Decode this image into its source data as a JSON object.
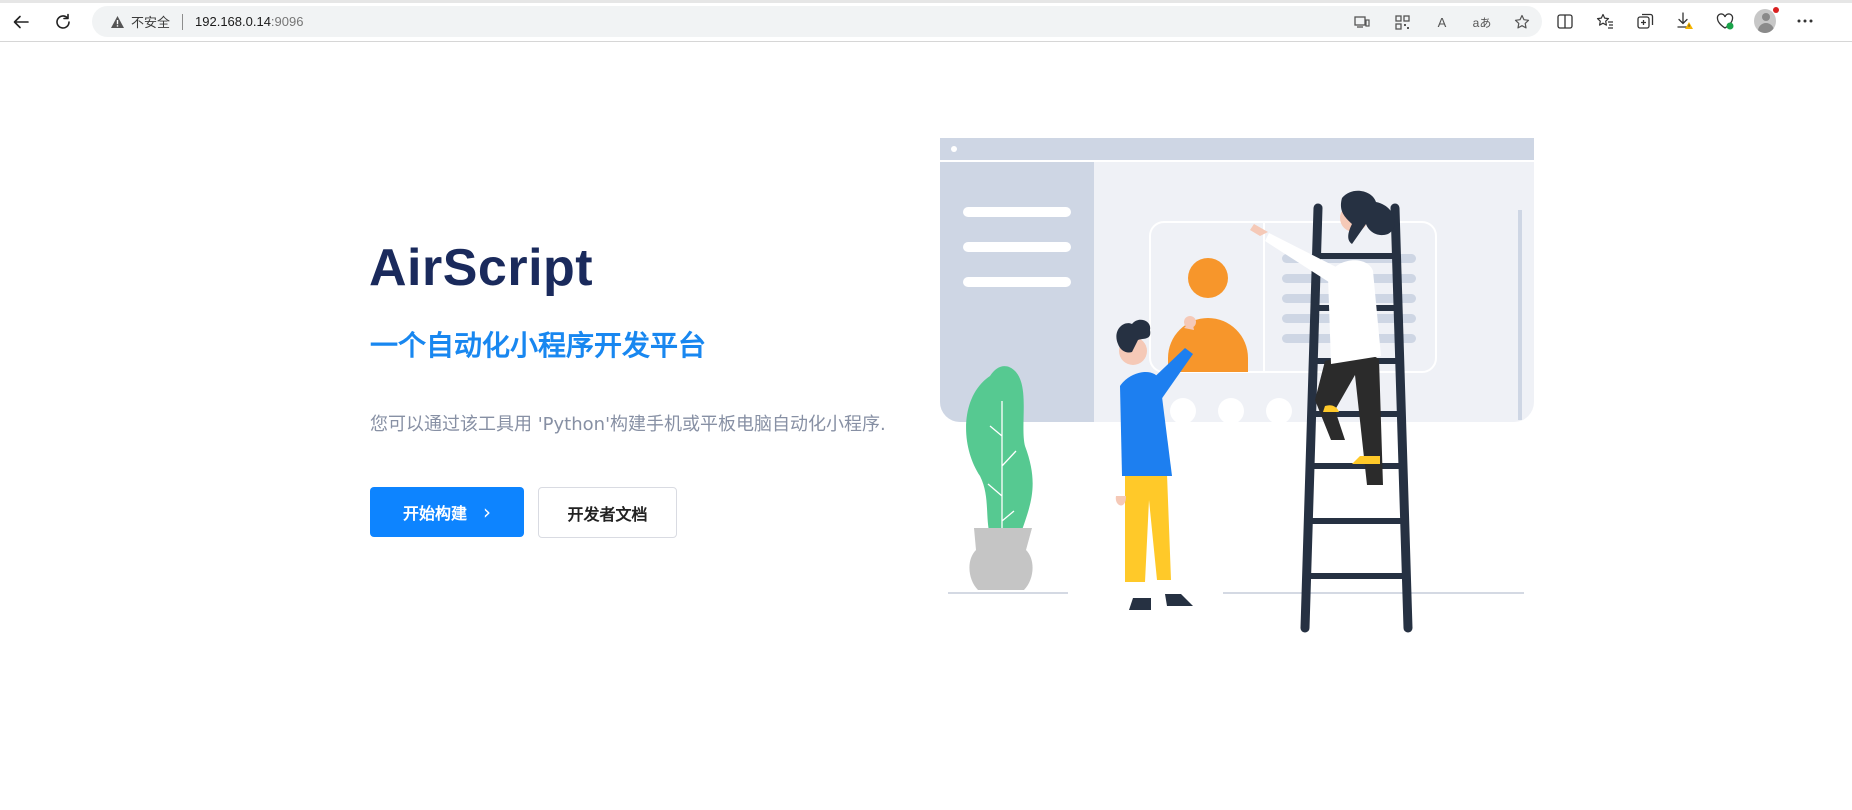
{
  "browser": {
    "security_label": "不安全",
    "url_host": "192.168.0.14",
    "url_port": ":9096",
    "read_aloud_glyph": "A",
    "translate_glyph": "aあ",
    "icons": {
      "back": "back-arrow-icon",
      "reload": "reload-icon",
      "warning": "warning-triangle-icon",
      "accent": "#d92020"
    }
  },
  "hero": {
    "title": "AirScript",
    "subtitle": "一个自动化小程序开发平台",
    "description": "您可以通过该工具用 'Python'构建手机或平板电脑自动化小程序.",
    "primary_button": "开始构建",
    "primary_arrow": "›",
    "secondary_button": "开发者文档",
    "colors": {
      "title": "#1a2a5c",
      "subtitle": "#1887f0",
      "primary_button": "#0d84ff"
    }
  }
}
